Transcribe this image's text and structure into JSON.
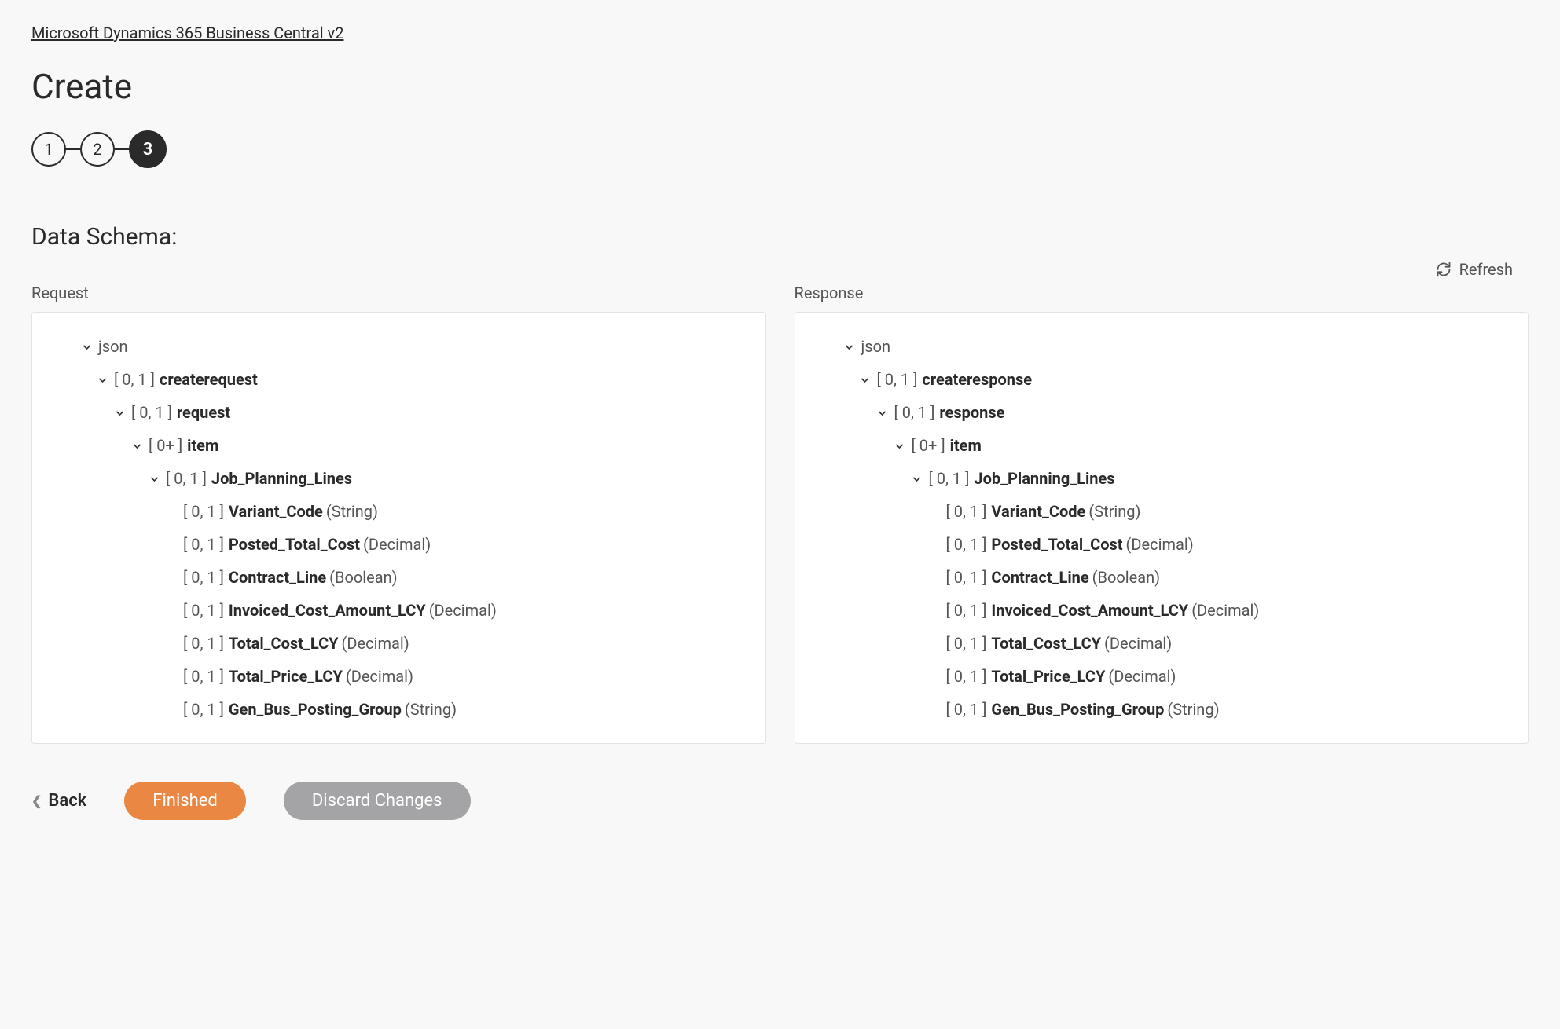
{
  "breadcrumb": "Microsoft Dynamics 365 Business Central v2",
  "page_title": "Create",
  "stepper": {
    "steps": [
      "1",
      "2",
      "3"
    ],
    "active_index": 2
  },
  "section_title": "Data Schema:",
  "refresh_label": "Refresh",
  "columns": {
    "request": {
      "title": "Request",
      "root": "json",
      "l1_card": "[ 0, 1 ]",
      "l1_name": "createrequest",
      "l2_card": "[ 0, 1 ]",
      "l2_name": "request",
      "l3_card": "[ 0+ ]",
      "l3_name": "item",
      "l4_card": "[ 0, 1 ]",
      "l4_name": "Job_Planning_Lines",
      "fields": [
        {
          "card": "[ 0, 1 ]",
          "name": "Variant_Code",
          "type": "(String)"
        },
        {
          "card": "[ 0, 1 ]",
          "name": "Posted_Total_Cost",
          "type": "(Decimal)"
        },
        {
          "card": "[ 0, 1 ]",
          "name": "Contract_Line",
          "type": "(Boolean)"
        },
        {
          "card": "[ 0, 1 ]",
          "name": "Invoiced_Cost_Amount_LCY",
          "type": "(Decimal)"
        },
        {
          "card": "[ 0, 1 ]",
          "name": "Total_Cost_LCY",
          "type": "(Decimal)"
        },
        {
          "card": "[ 0, 1 ]",
          "name": "Total_Price_LCY",
          "type": "(Decimal)"
        },
        {
          "card": "[ 0, 1 ]",
          "name": "Gen_Bus_Posting_Group",
          "type": "(String)"
        }
      ]
    },
    "response": {
      "title": "Response",
      "root": "json",
      "l1_card": "[ 0, 1 ]",
      "l1_name": "createresponse",
      "l2_card": "[ 0, 1 ]",
      "l2_name": "response",
      "l3_card": "[ 0+ ]",
      "l3_name": "item",
      "l4_card": "[ 0, 1 ]",
      "l4_name": "Job_Planning_Lines",
      "fields": [
        {
          "card": "[ 0, 1 ]",
          "name": "Variant_Code",
          "type": "(String)"
        },
        {
          "card": "[ 0, 1 ]",
          "name": "Posted_Total_Cost",
          "type": "(Decimal)"
        },
        {
          "card": "[ 0, 1 ]",
          "name": "Contract_Line",
          "type": "(Boolean)"
        },
        {
          "card": "[ 0, 1 ]",
          "name": "Invoiced_Cost_Amount_LCY",
          "type": "(Decimal)"
        },
        {
          "card": "[ 0, 1 ]",
          "name": "Total_Cost_LCY",
          "type": "(Decimal)"
        },
        {
          "card": "[ 0, 1 ]",
          "name": "Total_Price_LCY",
          "type": "(Decimal)"
        },
        {
          "card": "[ 0, 1 ]",
          "name": "Gen_Bus_Posting_Group",
          "type": "(String)"
        }
      ]
    }
  },
  "buttons": {
    "back": "Back",
    "finished": "Finished",
    "discard": "Discard Changes"
  }
}
